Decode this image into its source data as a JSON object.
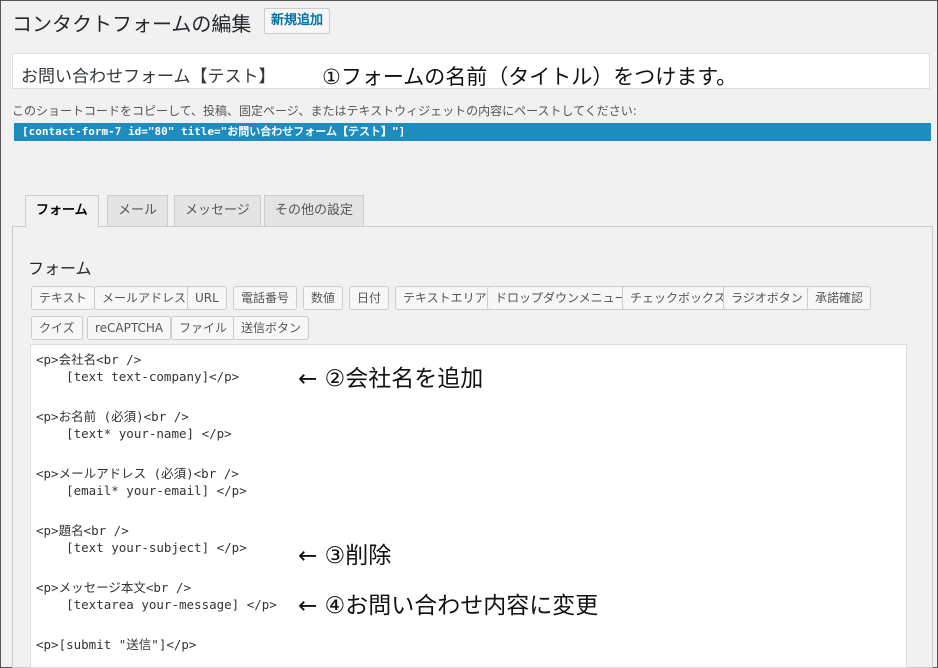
{
  "header": {
    "page_title": "コンタクトフォームの編集",
    "add_new_label": "新規追加"
  },
  "form_title": {
    "value": "お問い合わせフォーム【テスト】"
  },
  "annotations": {
    "a1": "①フォームの名前（タイトル）をつけます。",
    "a2": "← ②会社名を追加",
    "a3": "← ③削除",
    "a4": "← ④お問い合わせ内容に変更"
  },
  "shortcode": {
    "note": "このショートコードをコピーして、投稿、固定ページ、またはテキストウィジェットの内容にペーストしてください:",
    "code": "[contact-form-7 id=\"80\" title=\"お問い合わせフォーム【テスト】\"]"
  },
  "tabs": [
    {
      "label": "フォーム"
    },
    {
      "label": "メール"
    },
    {
      "label": "メッセージ"
    },
    {
      "label": "その他の設定"
    }
  ],
  "panel": {
    "heading": "フォーム"
  },
  "tag_buttons": [
    "テキスト",
    "メールアドレス",
    "URL",
    "電話番号",
    "数値",
    "日付",
    "テキストエリア",
    "ドロップダウンメニュー",
    "チェックボックス",
    "ラジオボタン",
    "承諾確認",
    "クイズ",
    "reCAPTCHA",
    "ファイル",
    "送信ボタン"
  ],
  "code_lines": [
    "<p>会社名<br />",
    "    [text text-company]</p>",
    "<p>お名前 (必須)<br />",
    "    [text* your-name] </p>",
    "<p>メールアドレス (必須)<br />",
    "    [email* your-email] </p>",
    "<p>題名<br />",
    "    [text your-subject] </p>",
    "<p>メッセージ本文<br />",
    "    [textarea your-message] </p>",
    "<p>[submit \"送信\"]</p>"
  ]
}
